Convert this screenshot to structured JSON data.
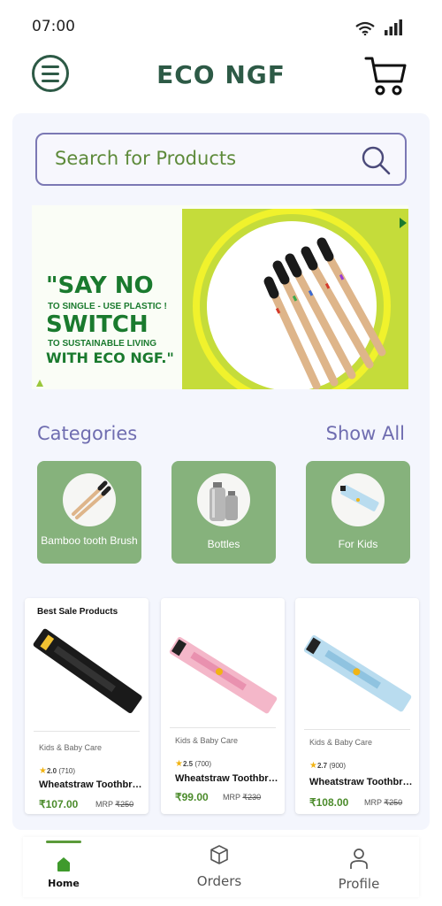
{
  "status_bar": {
    "time": "07:00",
    "wifi_icon": "wifi-icon",
    "signal_icon": "signal-icon"
  },
  "header": {
    "title": "ECO NGF",
    "menu_icon": "menu-icon",
    "cart_icon": "cart-icon"
  },
  "search": {
    "placeholder": "Search for Products",
    "icon": "search-icon"
  },
  "banner": {
    "line1": "\"SAY NO",
    "line2": "TO SINGLE - USE PLASTIC !",
    "line3": "SWITCH",
    "line4": "TO SUSTAINABLE LIVING",
    "line5": "WITH ECO NGF.\""
  },
  "categories": {
    "title": "Categories",
    "show_all": "Show All",
    "items": [
      {
        "label": "Bamboo tooth Brush",
        "icon": "bamboo-toothbrush-icon"
      },
      {
        "label": "Bottles",
        "icon": "bottles-icon"
      },
      {
        "label": "For Kids",
        "icon": "kids-toothbrush-icon"
      }
    ]
  },
  "products": {
    "heading": "Best Sale Products",
    "items": [
      {
        "category": "Kids & Baby Care",
        "rating": "2.0",
        "reviews": "(710)",
        "name": "Wheatstraw Toothbrush",
        "price": "₹107.00",
        "mrp_label": "MRP",
        "mrp": "₹250",
        "color": "#1a1a1a"
      },
      {
        "category": "Kids & Baby Care",
        "rating": "2.5",
        "reviews": "(700)",
        "name": "Wheatstraw Toothbrush",
        "price": "₹99.00",
        "mrp_label": "MRP",
        "mrp": "₹230",
        "color": "#f4b7c9"
      },
      {
        "category": "Kids & Baby Care",
        "rating": "2.7",
        "reviews": "(900)",
        "name": "Wheatstraw Toothbrush",
        "price": "₹108.00",
        "mrp_label": "MRP",
        "mrp": "₹250",
        "color": "#b9dcef"
      }
    ]
  },
  "bottom_nav": {
    "items": [
      {
        "label": "Home",
        "icon": "home-icon",
        "active": true
      },
      {
        "label": "Orders",
        "icon": "box-icon",
        "active": false
      },
      {
        "label": "Profile",
        "icon": "user-icon",
        "active": false
      }
    ]
  },
  "colors": {
    "brand": "#2d5a46",
    "accent": "#5b9a3a",
    "category_tile": "#86b27c",
    "heading_purple": "#6f6db0"
  }
}
